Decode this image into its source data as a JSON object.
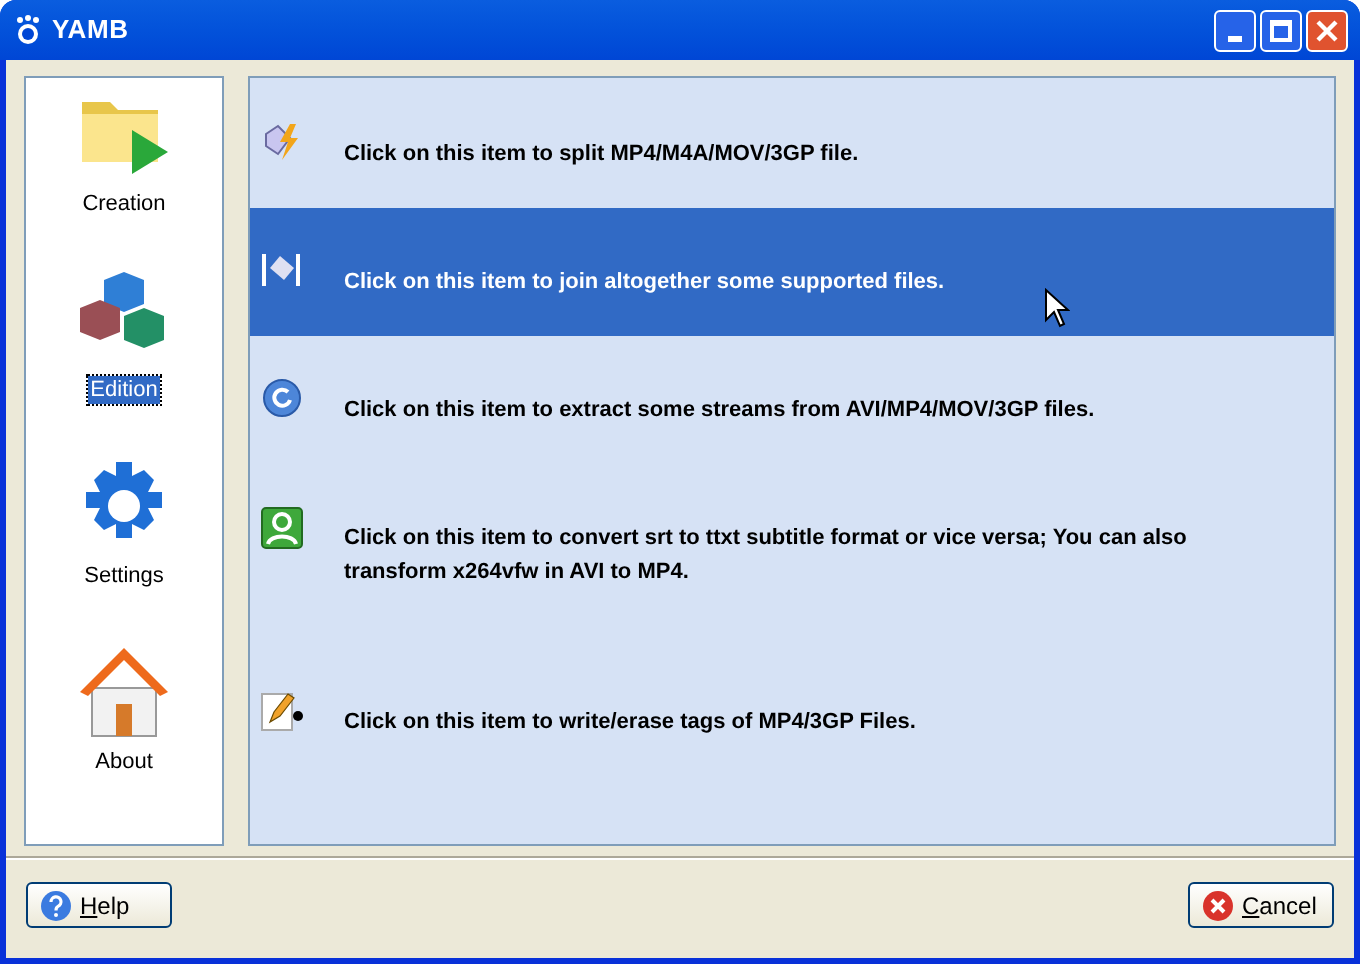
{
  "window": {
    "title": "YAMB"
  },
  "sidebar": {
    "items": [
      {
        "label": "Creation",
        "kind": "folder",
        "selected": false
      },
      {
        "label": "Edition",
        "kind": "cubes",
        "selected": true
      },
      {
        "label": "Settings",
        "kind": "gear",
        "selected": false
      },
      {
        "label": "About",
        "kind": "house",
        "selected": false
      }
    ]
  },
  "tasks": [
    {
      "text": "Click on this item to split MP4/M4A/MOV/3GP file.",
      "kind": "split",
      "selected": false
    },
    {
      "text": "Click on this item to join altogether some supported files.",
      "kind": "join",
      "selected": true
    },
    {
      "text": "Click on this item to extract some streams from AVI/MP4/MOV/3GP files.",
      "kind": "extract",
      "selected": false
    },
    {
      "text": "Click on this item to convert srt to ttxt subtitle format or vice versa; You can also transform x264vfw in AVI to MP4.",
      "kind": "convert",
      "selected": false
    },
    {
      "text": "Click on this item to write/erase tags of MP4/3GP Files.",
      "kind": "tags",
      "selected": false
    }
  ],
  "buttons": [
    {
      "label": "Help",
      "kind": "help"
    },
    {
      "label": "Cancel",
      "kind": "cancel"
    }
  ]
}
